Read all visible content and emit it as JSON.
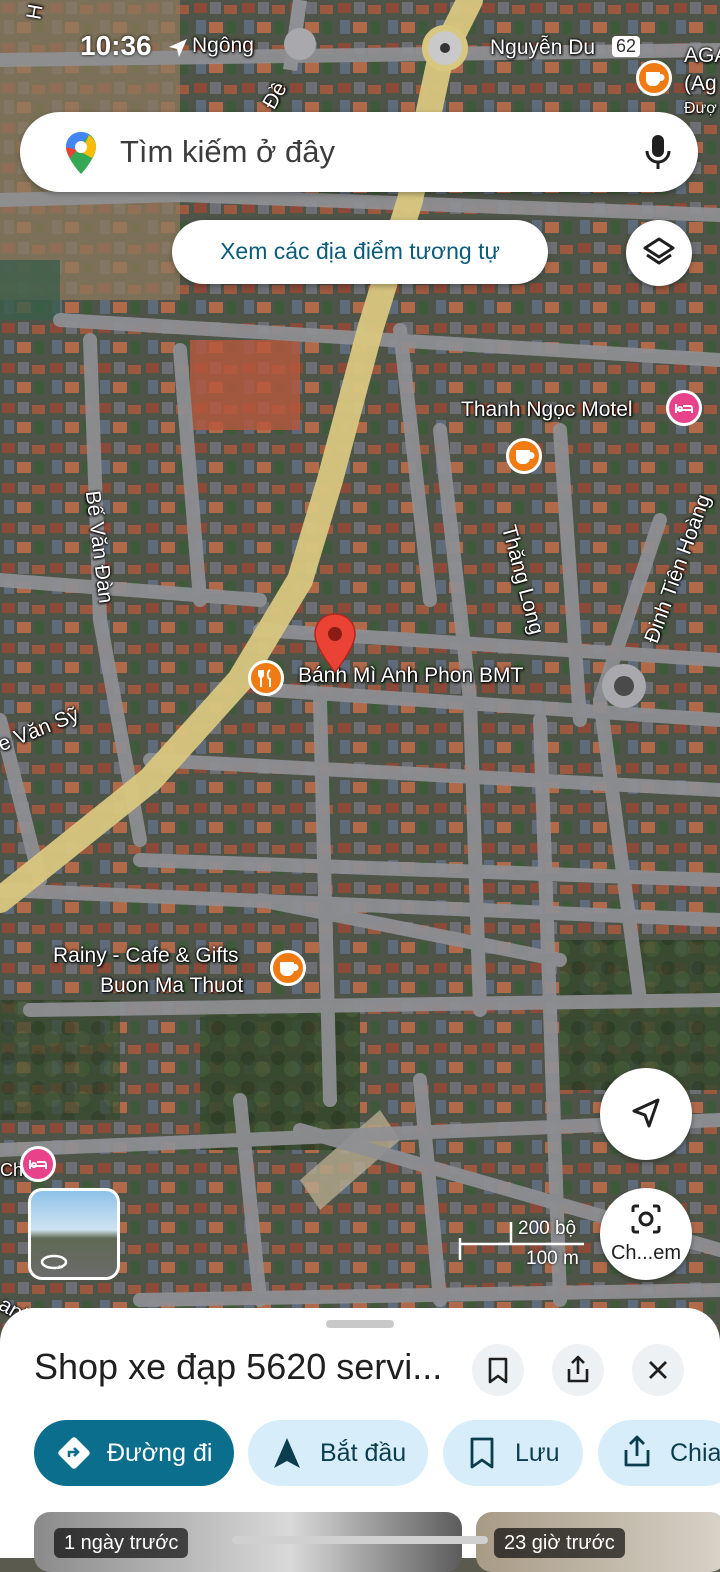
{
  "status_bar": {
    "time": "10:36"
  },
  "search": {
    "placeholder": "Tìm kiếm ở đây"
  },
  "similar_chip": {
    "label": "Xem các địa điểm tương tự"
  },
  "map": {
    "street_labels": [
      "Ngông",
      "Nguyễn Du",
      "Đề",
      "Bế Văn Đàn",
      "Thăng Long",
      "Đinh Tiên Hoàng",
      "e Văn Sỹ",
      "anh",
      "H",
      "AGA",
      "(Ag",
      "Đượ",
      "Ch"
    ],
    "places": {
      "bakery": "Bánh Mì Anh Phon BMT",
      "motel": "Thanh Ngọc Motel",
      "cafe_line1": "Rainy - Cafe & Gifts",
      "cafe_line2": "Buon Ma Thuot"
    },
    "route_badge": "62",
    "scale": {
      "imperial": "200 bộ",
      "metric": "100 m"
    },
    "lens_label": "Ch...em"
  },
  "sheet": {
    "title": "Shop xe đạp 5620 servi...",
    "actions": [
      "Đường đi",
      "Bắt đầu",
      "Lưu",
      "Chia"
    ],
    "photos": [
      "1 ngày trước",
      "23 giờ trước"
    ]
  },
  "colors": {
    "accent": "#0b6e8c",
    "chip_bg": "#d7eefa",
    "pin_red": "#ea4335",
    "poi_orange": "#f07b12",
    "poi_pink": "#e8428a"
  }
}
